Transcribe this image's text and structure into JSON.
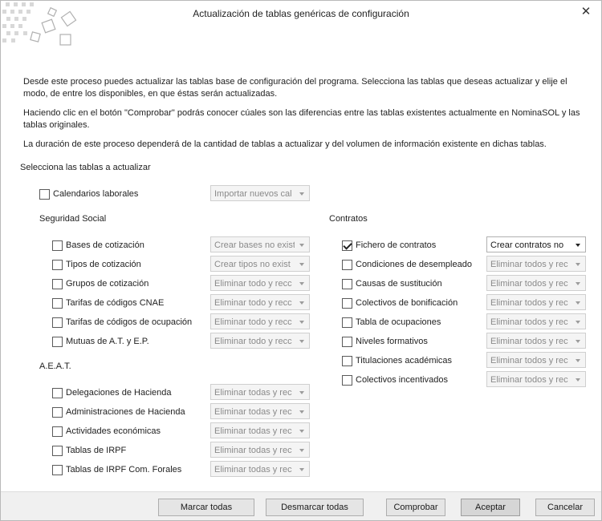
{
  "window": {
    "title": "Actualización de tablas genéricas de configuración",
    "close_glyph": "✕"
  },
  "intro": [
    "Desde este proceso puedes actualizar las tablas base de configuración del programa. Selecciona las tablas que deseas actualizar y elije el modo, de entre los disponibles, en que éstas serán actualizadas.",
    "Haciendo clic en el botón \"Comprobar\" podrás conocer cúales son las diferencias entre las tablas existentes actualmente en NominaSOL y las tablas originales.",
    "La duración de este proceso dependerá de la cantidad de tablas a actualizar y del volumen de información existente en dichas tablas."
  ],
  "select_prompt": "Selecciona las tablas a actualizar",
  "calendarios": {
    "label": "Calendarios laborales",
    "checked": false,
    "mode": "Importar nuevos cal"
  },
  "seguridad_social": {
    "heading": "Seguridad Social",
    "items": [
      {
        "label": "Bases de cotización",
        "checked": false,
        "mode": "Crear bases no exist"
      },
      {
        "label": "Tipos de cotización",
        "checked": false,
        "mode": "Crear tipos no exist"
      },
      {
        "label": "Grupos de cotización",
        "checked": false,
        "mode": "Eliminar todo y recc"
      },
      {
        "label": "Tarifas de códigos CNAE",
        "checked": false,
        "mode": "Eliminar todo y recc"
      },
      {
        "label": "Tarifas de códigos de ocupación",
        "checked": false,
        "mode": "Eliminar todo y recc"
      },
      {
        "label": "Mutuas de A.T. y E.P.",
        "checked": false,
        "mode": "Eliminar todo y recc"
      }
    ]
  },
  "aeat": {
    "heading": "A.E.A.T.",
    "items": [
      {
        "label": "Delegaciones de Hacienda",
        "checked": false,
        "mode": "Eliminar todas y rec"
      },
      {
        "label": "Administraciones de Hacienda",
        "checked": false,
        "mode": "Eliminar todas y rec"
      },
      {
        "label": "Actividades económicas",
        "checked": false,
        "mode": "Eliminar todas y rec"
      },
      {
        "label": "Tablas de IRPF",
        "checked": false,
        "mode": "Eliminar todas y rec"
      },
      {
        "label": "Tablas de IRPF Com. Forales",
        "checked": false,
        "mode": "Eliminar todas y rec"
      }
    ]
  },
  "contratos": {
    "heading": "Contratos",
    "items": [
      {
        "label": "Fichero de contratos",
        "checked": true,
        "mode": "Crear contratos no"
      },
      {
        "label": "Condiciones de desempleado",
        "checked": false,
        "mode": "Eliminar todos y rec"
      },
      {
        "label": "Causas de sustitución",
        "checked": false,
        "mode": "Eliminar todos y rec"
      },
      {
        "label": "Colectivos de bonificación",
        "checked": false,
        "mode": "Eliminar todos y rec"
      },
      {
        "label": "Tabla de ocupaciones",
        "checked": false,
        "mode": "Eliminar todos y rec"
      },
      {
        "label": "Niveles formativos",
        "checked": false,
        "mode": "Eliminar todos y rec"
      },
      {
        "label": "Titulaciones académicas",
        "checked": false,
        "mode": "Eliminar todos y rec"
      },
      {
        "label": "Colectivos incentivados",
        "checked": false,
        "mode": "Eliminar todos y rec"
      }
    ]
  },
  "buttons": {
    "select_all": "Marcar todas",
    "deselect_all": "Desmarcar todas",
    "check": "Comprobar",
    "accept": "Aceptar",
    "cancel": "Cancelar"
  }
}
